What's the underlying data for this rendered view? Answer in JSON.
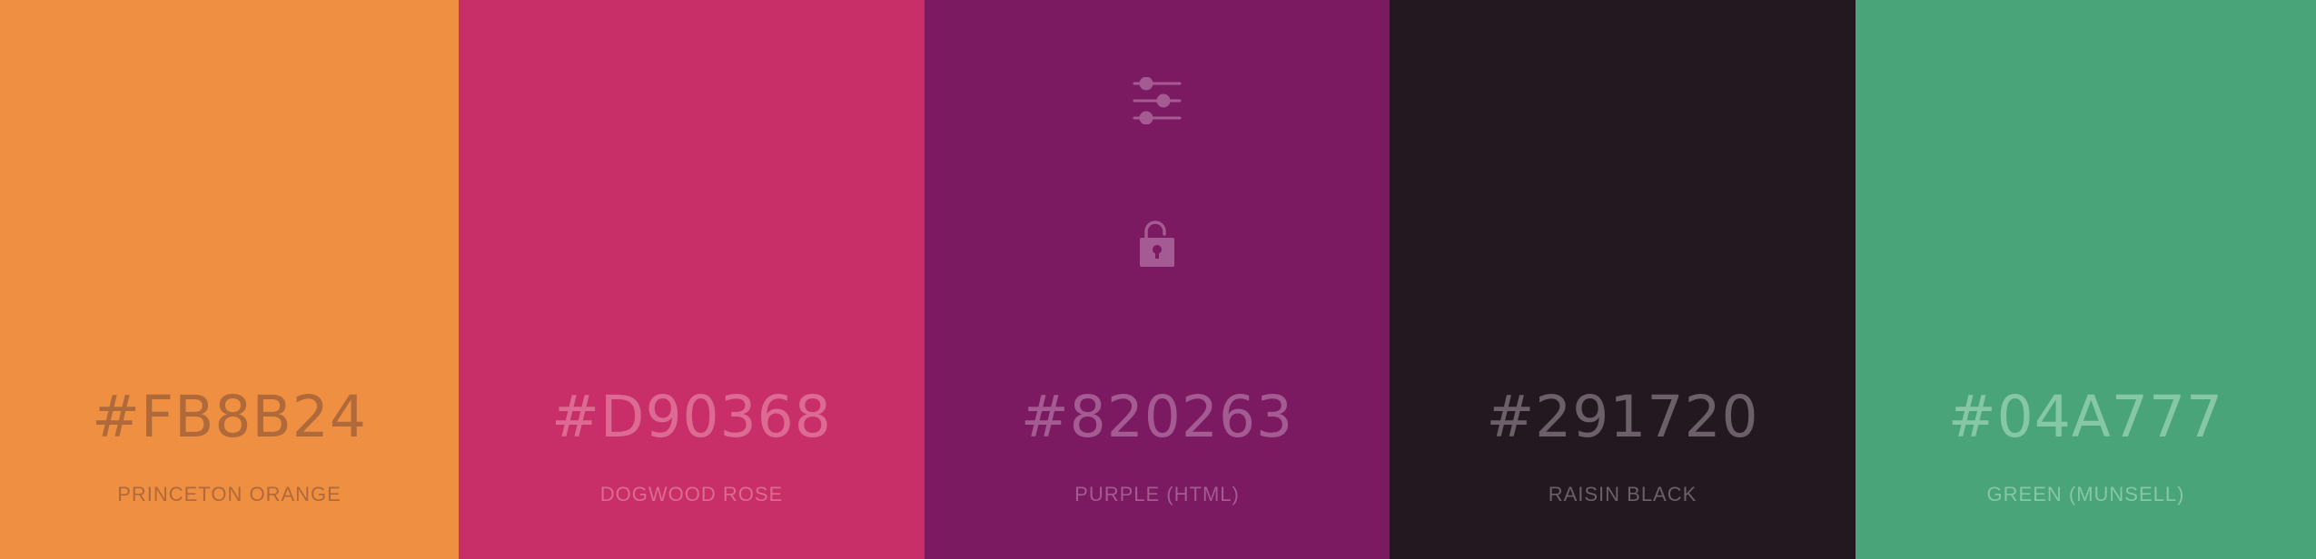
{
  "palette": {
    "swatches": [
      {
        "hex": "#FB8B24",
        "name": "PRINCETON ORANGE",
        "bg_color": "#ee8f41",
        "text_color": "#b0693a"
      },
      {
        "hex": "#D90368",
        "name": "DOGWOOD ROSE",
        "bg_color": "#c82f68",
        "text_color": "#dc6a93"
      },
      {
        "hex": "#820263",
        "name": "PURPLE (HTML)",
        "bg_color": "#7b1961",
        "text_color": "#a45b93"
      },
      {
        "hex": "#291720",
        "name": "RAISIN BLACK",
        "bg_color": "#231820",
        "text_color": "#6d5f69"
      },
      {
        "hex": "#04A777",
        "name": "GREEN (MUNSELL)",
        "bg_color": "#49a47a",
        "text_color": "#86c7a6"
      }
    ],
    "hover_tools": {
      "swatch_index": 2,
      "icons": [
        "sliders-icon",
        "unlock-icon"
      ],
      "icon_color": "#a45b93"
    }
  }
}
